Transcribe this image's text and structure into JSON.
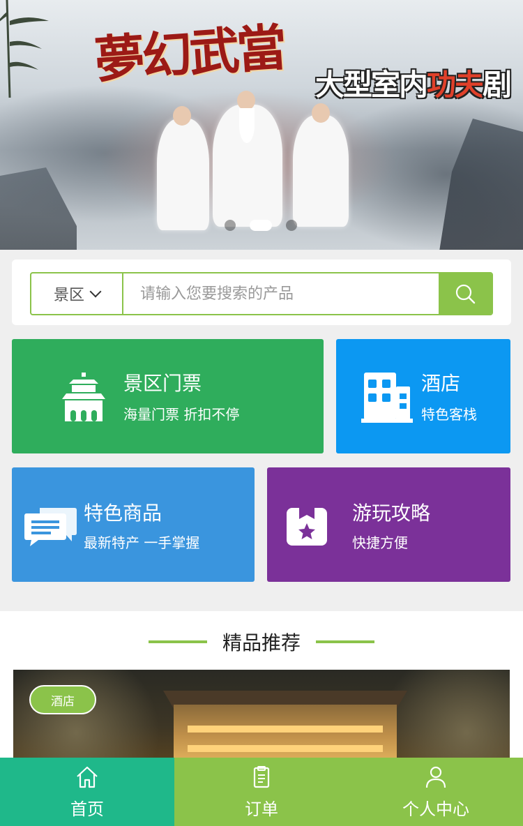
{
  "banner": {
    "title": "夢幻武當",
    "subtitle_pre": "大型室内",
    "subtitle_highlight": "功夫",
    "subtitle_post": "剧",
    "slide_count": 3,
    "active_slide": 2
  },
  "search": {
    "category": "景区",
    "placeholder": "请输入您要搜索的产品"
  },
  "tiles": {
    "tickets": {
      "title": "景区门票",
      "subtitle": "海量门票  折扣不停",
      "color": "#2fad5c"
    },
    "hotel": {
      "title": "酒店",
      "subtitle": "特色客栈",
      "color": "#0c98f2"
    },
    "goods": {
      "title": "特色商品",
      "subtitle": "最新特产  一手掌握",
      "color": "#3a95de"
    },
    "guide": {
      "title": "游玩攻略",
      "subtitle": "快捷方便",
      "color": "#7b3199"
    }
  },
  "recommend": {
    "title": "精品推荐",
    "badge": "酒店"
  },
  "nav": {
    "home": "首页",
    "orders": "订单",
    "profile": "个人中心"
  },
  "colors": {
    "accent": "#8bc34a",
    "nav_active": "#1fb88a"
  }
}
